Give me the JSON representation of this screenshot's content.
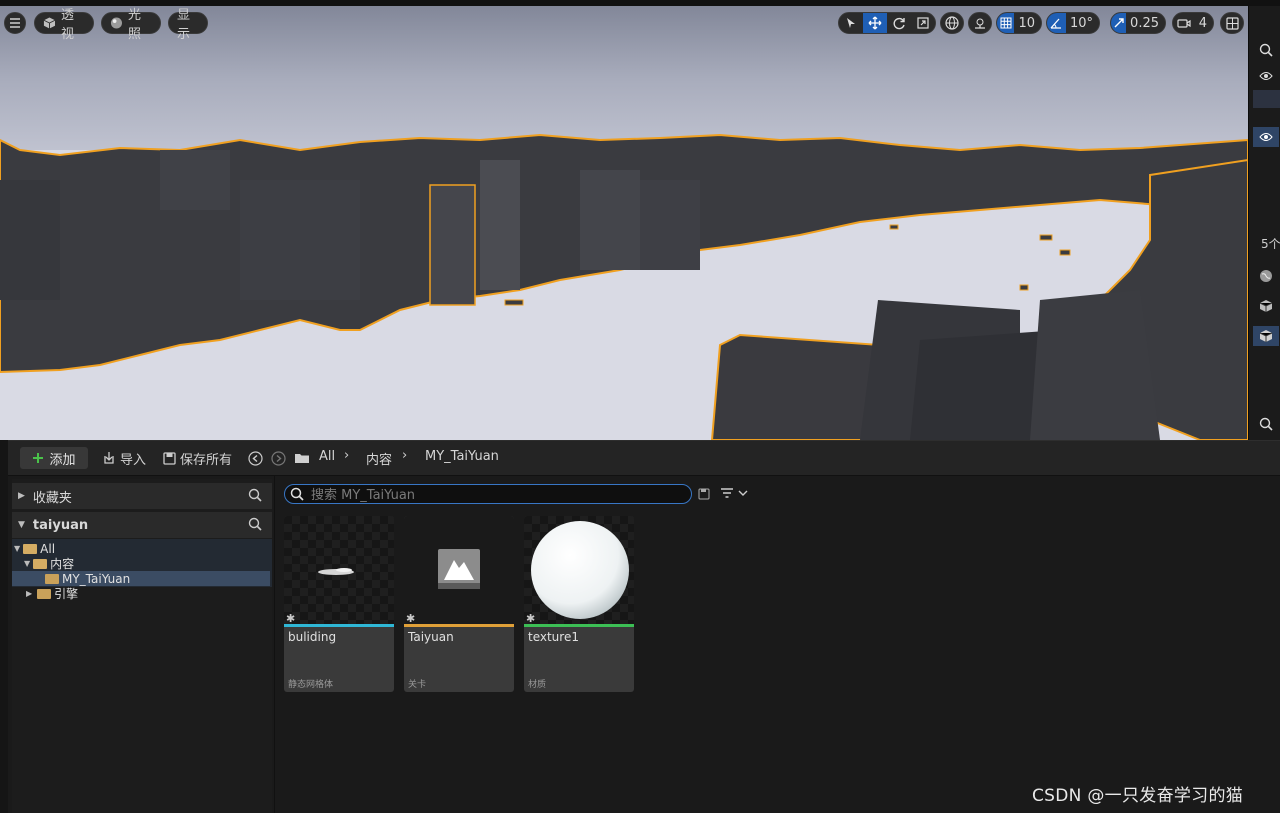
{
  "viewport": {
    "view_mode_label": "透视",
    "lighting_label": "光照",
    "show_label": "显示",
    "grid_snap_value": "10",
    "rotation_snap_value": "10°",
    "scale_snap_value": "0.25",
    "camera_speed_value": "4",
    "icons": [
      "menu-icon",
      "perspective-cube-icon",
      "lighting-sphere-icon",
      "select-arrow-icon",
      "move-icon",
      "rotate-icon",
      "scale-icon",
      "globe-icon",
      "surface-snap-icon",
      "grid-icon",
      "angle-icon",
      "scale-snap-icon",
      "camera-icon",
      "layout-icon"
    ]
  },
  "right_panel": {
    "count_label": "5个"
  },
  "toolbar": {
    "add_label": "添加",
    "import_label": "导入",
    "save_all_label": "保存所有",
    "breadcrumb": [
      "All",
      "内容",
      "MY_TaiYuan"
    ]
  },
  "tree": {
    "favorites_label": "收藏夹",
    "project_label": "taiyuan",
    "items": [
      {
        "label": "All"
      },
      {
        "label": "内容"
      },
      {
        "label": "MY_TaiYuan"
      },
      {
        "label": "引擎"
      }
    ]
  },
  "search": {
    "placeholder": "搜索 MY_TaiYuan"
  },
  "assets": [
    {
      "name": "buliding",
      "type": "静态网格体",
      "bar_color": "#2fb7d6"
    },
    {
      "name": "Taiyuan",
      "type": "关卡",
      "bar_color": "#e0a038"
    },
    {
      "name": "texture1",
      "type": "材质",
      "bar_color": "#3cbf55"
    }
  ],
  "watermark": "CSDN @一只发奋学习的猫"
}
